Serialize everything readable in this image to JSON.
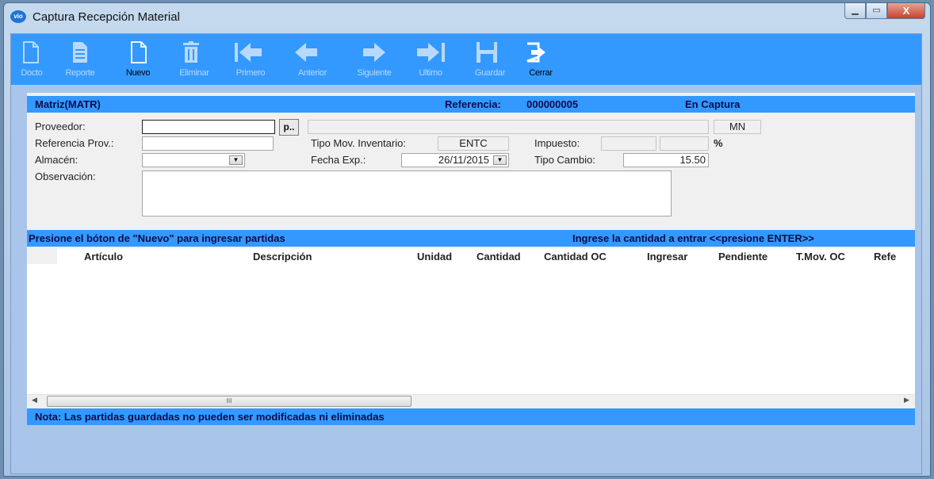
{
  "window": {
    "icon_text": "vio",
    "title": "Captura Recepción Material",
    "min_symbol": "▁",
    "max_symbol": "▭",
    "close_symbol": "X"
  },
  "toolbar": {
    "buttons": [
      {
        "label": "Docto",
        "icon": "document-icon",
        "active": false
      },
      {
        "label": "Reporte",
        "icon": "report-icon",
        "active": false
      },
      {
        "label": "Nuevo",
        "icon": "new-document-icon",
        "active": true
      },
      {
        "label": "Eliminar",
        "icon": "trash-icon",
        "active": false
      },
      {
        "label": "Primero",
        "icon": "first-arrow-icon",
        "active": false
      },
      {
        "label": "Anterior",
        "icon": "previous-arrow-icon",
        "active": false
      },
      {
        "label": "Siguiente",
        "icon": "next-arrow-icon",
        "active": false
      },
      {
        "label": "Ultimo",
        "icon": "last-arrow-icon",
        "active": false
      },
      {
        "label": "Guardar",
        "icon": "save-icon",
        "active": false
      },
      {
        "label": "Cerrar",
        "icon": "exit-icon",
        "active": true
      }
    ]
  },
  "header": {
    "warehouse": "Matriz(MATR)",
    "reference_label": "Referencia:",
    "reference_value": "000000005",
    "status": "En Captura"
  },
  "form": {
    "proveedor_label": "Proveedor:",
    "proveedor_value": "",
    "lookup_button": "p..",
    "proveedor_name": "",
    "currency": "MN",
    "referencia_prov_label": "Referencia Prov.:",
    "referencia_prov_value": "",
    "tipo_mov_label": "Tipo Mov. Inventario:",
    "tipo_mov_value": "ENTC",
    "impuesto_label": "Impuesto:",
    "impuesto_value": "",
    "impuesto_pct": "",
    "percent_symbol": "%",
    "almacen_label": "Almacén:",
    "almacen_value": "",
    "fecha_exp_label": "Fecha Exp.:",
    "fecha_exp_value": "26/11/2015",
    "tipo_cambio_label": "Tipo Cambio:",
    "tipo_cambio_value": "15.50",
    "observacion_label": "Observación:",
    "observacion_value": ""
  },
  "instructions": {
    "left": "Presione el bóton de \"Nuevo\" para ingresar partidas",
    "right": "Ingrese la cantidad a entrar <<presione ENTER>>"
  },
  "grid": {
    "columns": [
      "Artículo",
      "Descripción",
      "Unidad",
      "Cantidad",
      "Cantidad OC",
      "Ingresar",
      "Pendiente",
      "T.Mov. OC",
      "Refe"
    ],
    "rows": []
  },
  "scrollbar": {
    "left_arrow": "◀",
    "right_arrow": "▶",
    "grip": "III"
  },
  "note": "Nota: Las partidas guardadas no pueden ser modificadas ni eliminadas",
  "colors": {
    "accent_blue": "#3399ff",
    "toolbar_disabled_text": "#b9d9fb"
  }
}
